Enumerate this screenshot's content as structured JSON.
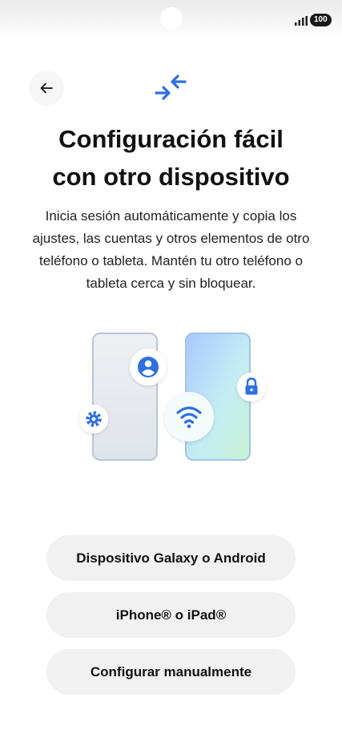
{
  "status_bar": {
    "battery_level": "100",
    "signal_icon": "signal-bars-icon"
  },
  "header": {
    "back_icon": "arrow-left-icon",
    "feature_icon": "transfer-arrows-icon"
  },
  "main": {
    "title_line1": "Configuración fácil",
    "title_line2": "con otro dispositivo",
    "description": "Inicia sesión automáticamente y copia los ajustes, las cuentas y otros elementos de otro teléfono o tableta. Mantén tu otro teléfono o tableta cerca y sin bloquear."
  },
  "illustration": {
    "icons": [
      "phone-icon",
      "account-icon",
      "gear-icon",
      "wifi-icon",
      "lock-icon"
    ]
  },
  "options": [
    {
      "label": "Dispositivo Galaxy o Android"
    },
    {
      "label": "iPhone® o iPad®"
    },
    {
      "label": "Configurar manualmente"
    }
  ],
  "colors": {
    "accent": "#2f6fe0",
    "button_bg": "#f1f1f1",
    "text": "#111111"
  }
}
